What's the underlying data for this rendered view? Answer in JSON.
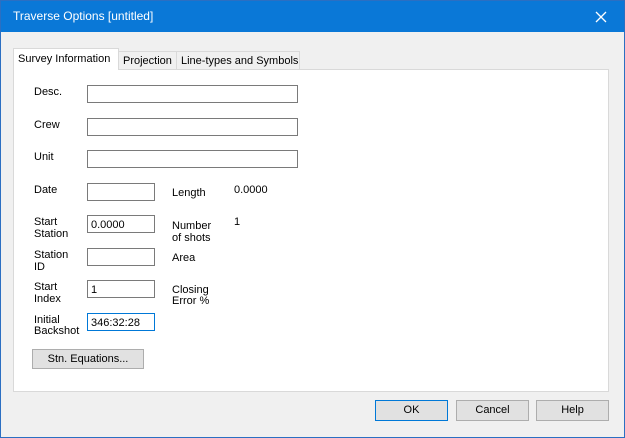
{
  "window": {
    "title": "Traverse Options [untitled]"
  },
  "tabs": [
    "Survey Information",
    "Projection",
    "Line-types and Symbols"
  ],
  "fields": {
    "desc": {
      "label": "Desc.",
      "value": ""
    },
    "crew": {
      "label": "Crew",
      "value": ""
    },
    "unit": {
      "label": "Unit",
      "value": ""
    },
    "date": {
      "label": "Date",
      "value": ""
    },
    "start_station": {
      "label_line1": "Start",
      "label_line2": "Station",
      "value": "0.0000"
    },
    "station_id": {
      "label_line1": "Station",
      "label_line2": "ID",
      "value": ""
    },
    "start_index": {
      "label_line1": "Start",
      "label_line2": "Index",
      "value": "1"
    },
    "initial_backshot": {
      "label_line1": "Initial",
      "label_line2": "Backshot",
      "value": "346:32:28"
    }
  },
  "info": {
    "length": {
      "label": "Length",
      "value": "0.0000"
    },
    "number_of_shots": {
      "label_line1": "Number",
      "label_line2": "of shots",
      "value": "1"
    },
    "area": {
      "label": "Area",
      "value": ""
    },
    "closing_error": {
      "label_line1": "Closing",
      "label_line2": "Error %",
      "value": ""
    }
  },
  "buttons": {
    "stn_equations": "Stn. Equations...",
    "ok": "OK",
    "cancel": "Cancel",
    "help": "Help"
  }
}
